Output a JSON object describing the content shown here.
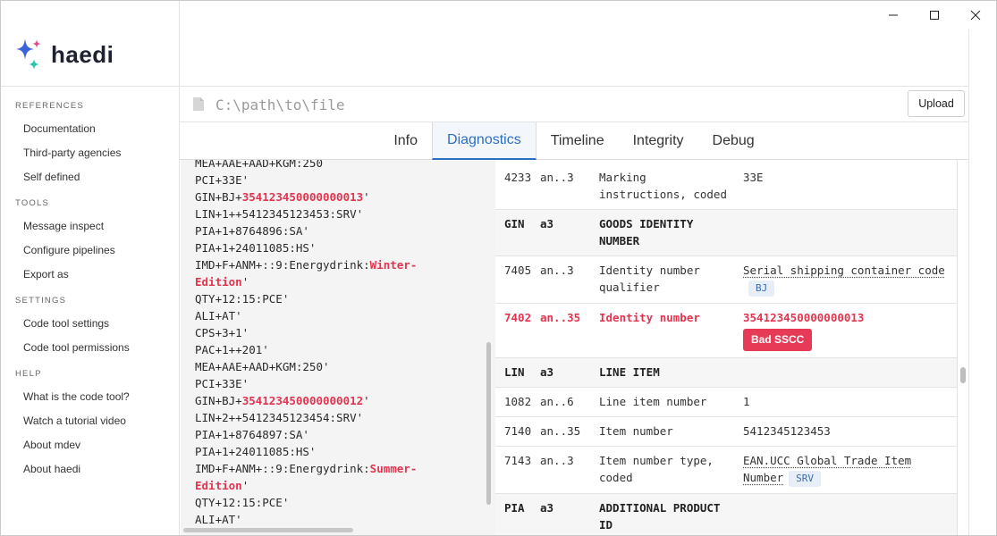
{
  "app": {
    "name": "haedi"
  },
  "colors": {
    "accent": "#2b6fc2",
    "error": "#e3344f",
    "badge": "#e63a57",
    "logo_blue": "#3b63d9",
    "logo_teal": "#22c7b0",
    "logo_pink": "#e24b8a"
  },
  "window_controls": {
    "minimize_icon": "minimize-icon",
    "maximize_icon": "maximize-icon",
    "close_icon": "close-icon"
  },
  "sidebar": {
    "sections": [
      {
        "title": "REFERENCES",
        "items": [
          "Documentation",
          "Third-party agencies",
          "Self defined"
        ]
      },
      {
        "title": "TOOLS",
        "items": [
          "Message inspect",
          "Configure pipelines",
          "Export as"
        ]
      },
      {
        "title": "SETTINGS",
        "items": [
          "Code tool settings",
          "Code tool permissions"
        ]
      },
      {
        "title": "HELP",
        "items": [
          "What is the code tool?",
          "Watch a tutorial video",
          "About mdev",
          "About haedi"
        ]
      }
    ]
  },
  "path": {
    "placeholder": "C:\\path\\to\\file",
    "upload_label": "Upload"
  },
  "tabs": [
    {
      "label": "Info",
      "active": false
    },
    {
      "label": "Diagnostics",
      "active": true
    },
    {
      "label": "Timeline",
      "active": false
    },
    {
      "label": "Integrity",
      "active": false
    },
    {
      "label": "Debug",
      "active": false
    }
  ],
  "code_lines": [
    [
      {
        "t": "MEA+AAE+AAD+KGM:250"
      }
    ],
    [
      {
        "t": "PCI+33E'"
      }
    ],
    [
      {
        "t": "GIN+BJ+"
      },
      {
        "t": "354123450000000013",
        "hl": true
      },
      {
        "t": "'"
      }
    ],
    [
      {
        "t": "LIN+1++5412345123453:SRV'"
      }
    ],
    [
      {
        "t": "PIA+1+8764896:SA'"
      }
    ],
    [
      {
        "t": "PIA+1+24011085:HS'"
      }
    ],
    [
      {
        "t": "IMD+F+ANM+::9:Energydrink:"
      },
      {
        "t": "Winter-",
        "hl": true
      }
    ],
    [
      {
        "t": "Edition",
        "hl": true
      },
      {
        "t": "'"
      }
    ],
    [
      {
        "t": "QTY+12:15:PCE'"
      }
    ],
    [
      {
        "t": "ALI+AT'"
      }
    ],
    [
      {
        "t": "CPS+3+1'"
      }
    ],
    [
      {
        "t": "PAC+1++201'"
      }
    ],
    [
      {
        "t": "MEA+AAE+AAD+KGM:250'"
      }
    ],
    [
      {
        "t": "PCI+33E'"
      }
    ],
    [
      {
        "t": "GIN+BJ+"
      },
      {
        "t": "354123450000000012",
        "hl": true
      },
      {
        "t": "'"
      }
    ],
    [
      {
        "t": "LIN+2++5412345123454:SRV'"
      }
    ],
    [
      {
        "t": "PIA+1+8764897:SA'"
      }
    ],
    [
      {
        "t": "PIA+1+24011085:HS'"
      }
    ],
    [
      {
        "t": "IMD+F+ANM+::9:Energydrink:"
      },
      {
        "t": "Summer-",
        "hl": true
      }
    ],
    [
      {
        "t": "Edition",
        "hl": true
      },
      {
        "t": "'"
      }
    ],
    [
      {
        "t": "QTY+12:15:PCE'"
      }
    ],
    [
      {
        "t": "ALI+AT'"
      }
    ]
  ],
  "table_rows": [
    {
      "type": "field",
      "c1": "4233",
      "c2": "an..3",
      "c3": "Marking instructions, coded",
      "c4": "33E"
    },
    {
      "type": "segment",
      "c1": "GIN",
      "c2": "a3",
      "c3": "GOODS IDENTITY NUMBER",
      "c4": ""
    },
    {
      "type": "field",
      "c1": "7405",
      "c2": "an..3",
      "c3": "Identity number qualifier",
      "c4": "Serial shipping container code",
      "dotted": true,
      "tag": "BJ"
    },
    {
      "type": "error",
      "c1": "7402",
      "c2": "an..35",
      "c3": "Identity number",
      "c4": "354123450000000013",
      "badge": "Bad SSCC"
    },
    {
      "type": "segment",
      "c1": "LIN",
      "c2": "a3",
      "c3": "LINE ITEM",
      "c4": ""
    },
    {
      "type": "field",
      "c1": "1082",
      "c2": "an..6",
      "c3": "Line item number",
      "c4": "1"
    },
    {
      "type": "field",
      "c1": "7140",
      "c2": "an..35",
      "c3": "Item number",
      "c4": "5412345123453"
    },
    {
      "type": "field",
      "c1": "7143",
      "c2": "an..3",
      "c3": "Item number type, coded",
      "c4": "EAN.UCC Global Trade Item Number",
      "dotted": true,
      "tag": "SRV"
    },
    {
      "type": "segment",
      "c1": "PIA",
      "c2": "a3",
      "c3": "ADDITIONAL PRODUCT ID",
      "c4": ""
    }
  ]
}
